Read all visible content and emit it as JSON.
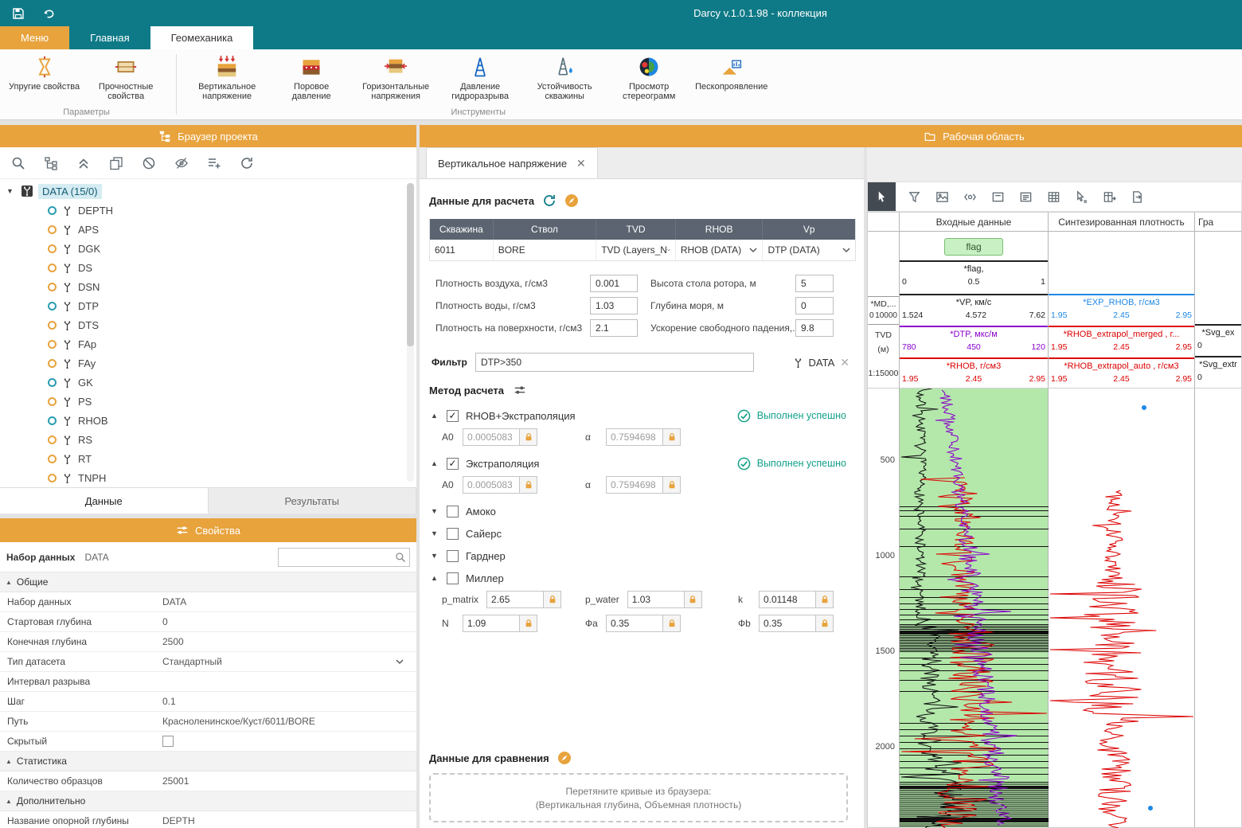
{
  "titlebar": {
    "title": "Darcy v.1.0.1.98 - коллекция"
  },
  "menu_tabs": [
    {
      "label": "Меню"
    },
    {
      "label": "Главная"
    },
    {
      "label": "Геомеханика"
    }
  ],
  "ribbon": {
    "groups": [
      {
        "label": "Параметры",
        "items": [
          {
            "label": "Упругие свойства"
          },
          {
            "label": "Прочностные свойства"
          }
        ]
      },
      {
        "label": "Инструменты",
        "items": [
          {
            "label": "Вертикальное напряжение"
          },
          {
            "label": "Поровое давление"
          },
          {
            "label": "Горизонтальные напряжения"
          },
          {
            "label": "Давление гидроразрыва"
          },
          {
            "label": "Устойчивость скважины"
          },
          {
            "label": "Просмотр стереограмм"
          },
          {
            "label": "Пескопроявление"
          }
        ]
      }
    ]
  },
  "project_browser": {
    "title": "Браузер проекта",
    "root_label": "DATA (15/0)",
    "items": [
      {
        "label": "DEPTH",
        "ring": "teal"
      },
      {
        "label": "APS",
        "ring": "orange"
      },
      {
        "label": "DGK",
        "ring": "orange"
      },
      {
        "label": "DS",
        "ring": "orange"
      },
      {
        "label": "DSN",
        "ring": "orange"
      },
      {
        "label": "DTP",
        "ring": "teal"
      },
      {
        "label": "DTS",
        "ring": "orange"
      },
      {
        "label": "FAp",
        "ring": "orange"
      },
      {
        "label": "FAy",
        "ring": "orange"
      },
      {
        "label": "GK",
        "ring": "teal"
      },
      {
        "label": "PS",
        "ring": "orange"
      },
      {
        "label": "RHOB",
        "ring": "teal"
      },
      {
        "label": "RS",
        "ring": "orange"
      },
      {
        "label": "RT",
        "ring": "orange"
      },
      {
        "label": "TNPH",
        "ring": "orange"
      }
    ],
    "tabs": [
      {
        "label": "Данные"
      },
      {
        "label": "Результаты"
      }
    ]
  },
  "properties": {
    "title": "Свойства",
    "dataset_label": "Набор данных",
    "dataset_value": "DATA",
    "rows": [
      {
        "type": "section",
        "label": "Общие"
      },
      {
        "type": "text",
        "label": "Набор данных",
        "value": "DATA"
      },
      {
        "type": "text",
        "label": "Стартовая глубина",
        "value": "0"
      },
      {
        "type": "text",
        "label": "Конечная глубина",
        "value": "2500"
      },
      {
        "type": "select",
        "label": "Тип датасета",
        "value": "Стандартный"
      },
      {
        "type": "text",
        "label": "Интервал разрыва",
        "value": ""
      },
      {
        "type": "text",
        "label": "Шаг",
        "value": "0.1"
      },
      {
        "type": "text",
        "label": "Путь",
        "value": "Красноленинское/Куст/6011/BORE"
      },
      {
        "type": "checkbox",
        "label": "Скрытый",
        "checked": false
      },
      {
        "type": "section",
        "label": "Статистика"
      },
      {
        "type": "text",
        "label": "Количество образцов",
        "value": "25001"
      },
      {
        "type": "section",
        "label": "Дополнительно"
      },
      {
        "type": "text",
        "label": "Название опорной глубины",
        "value": "DEPTH"
      }
    ]
  },
  "workspace": {
    "title": "Рабочая область",
    "tab_label": "Вертикальное напряжение",
    "calc": {
      "title": "Данные для расчета",
      "table_headers": [
        "Скважина",
        "Ствол",
        "TVD",
        "RHOB",
        "Vp"
      ],
      "table_row": {
        "well": "6011",
        "bore": "BORE",
        "tvd": "TVD (Layers_N",
        "rhob": "RHOB (DATA)",
        "vp": "DTP (DATA)"
      },
      "params_left": [
        {
          "label": "Плотность воздуха, г/см3",
          "value": "0.001"
        },
        {
          "label": "Плотность воды, г/см3",
          "value": "1.03"
        },
        {
          "label": "Плотность на поверхности, г/см3",
          "value": "2.1"
        }
      ],
      "params_right": [
        {
          "label": "Высота стола ротора, м",
          "value": "5"
        },
        {
          "label": "Глубина моря, м",
          "value": "0"
        },
        {
          "label": "Ускорение свободного падения,...",
          "value": "9.8"
        }
      ]
    },
    "filter": {
      "label": "Фильтр",
      "value": "DTP>350",
      "badge": "DATA"
    },
    "methods": {
      "title": "Метод расчета",
      "items": [
        {
          "name": "RHOB+Экстраполяция",
          "checked": true,
          "expanded": true,
          "status": "Выполнен успешно",
          "params": [
            {
              "label": "A0",
              "value": "0.0005083"
            },
            {
              "label": "α",
              "value": "0.7594698"
            }
          ]
        },
        {
          "name": "Экстраполяция",
          "checked": true,
          "expanded": true,
          "status": "Выполнен успешно",
          "params": [
            {
              "label": "A0",
              "value": "0.0005083"
            },
            {
              "label": "α",
              "value": "0.7594698"
            }
          ]
        },
        {
          "name": "Амоко",
          "checked": false,
          "expanded": false
        },
        {
          "name": "Сайерс",
          "checked": false,
          "expanded": false
        },
        {
          "name": "Гарднер",
          "checked": false,
          "expanded": false
        },
        {
          "name": "Миллер",
          "checked": false,
          "expanded": true,
          "params": [
            {
              "label": "p_matrix",
              "value": "2.65"
            },
            {
              "label": "p_water",
              "value": "1.03"
            },
            {
              "label": "k",
              "value": "0.01148"
            },
            {
              "label": "N",
              "value": "1.09"
            },
            {
              "label": "Фа",
              "value": "0.35"
            },
            {
              "label": "Фb",
              "value": "0.35"
            }
          ]
        }
      ]
    },
    "compare": {
      "title": "Данные для сравнения",
      "drop_line1": "Перетяните кривые из браузера:",
      "drop_line2": "(Вертикальная глубина, Объемная плотность)"
    }
  },
  "plot": {
    "groups": [
      "Входные данные",
      "Синтезированная плотность",
      "Гра"
    ],
    "flag_chip": "flag",
    "depth_header": {
      "md": "*MD,...",
      "md_min": "0",
      "md_max": "10000",
      "tvd_line1": "TVD",
      "tvd_line2": "(м)",
      "scale": "1:15000"
    },
    "track1_curves": [
      {
        "name": "*flag,",
        "color": "#222222",
        "min": "0",
        "mid": "0.5",
        "max": "1"
      },
      {
        "name": "*VP, км/с",
        "color": "#222222",
        "min": "1.524",
        "mid": "4.572",
        "max": "7.62"
      },
      {
        "name": "*DTP, мкс/м",
        "color": "#8a00cc",
        "min": "780",
        "mid": "450",
        "max": "120"
      },
      {
        "name": "*RHOB, г/см3",
        "color": "#dd0000",
        "min": "1.95",
        "mid": "2.45",
        "max": "2.95"
      }
    ],
    "track2_curves": [
      {
        "name": "*EXP_RHOB, г/см3",
        "color": "#1e88e5",
        "min": "1.95",
        "mid": "2.45",
        "max": "2.95"
      },
      {
        "name": "*RHOB_extrapol_merged , г...",
        "color": "#dd0000",
        "min": "1.95",
        "mid": "2.45",
        "max": "2.95"
      },
      {
        "name": "*RHOB_extrapol_auto , г/см3",
        "color": "#dd0000",
        "min": "1.95",
        "mid": "2.45",
        "max": "2.95"
      }
    ],
    "track3_curves": [
      {
        "name": "*Svg_ex",
        "color": "#222222",
        "min": "0"
      },
      {
        "name": "*Svg_extr",
        "color": "#222222",
        "min": "0"
      }
    ],
    "depth_ticks": [
      "500",
      "1000",
      "1500",
      "2000"
    ]
  }
}
